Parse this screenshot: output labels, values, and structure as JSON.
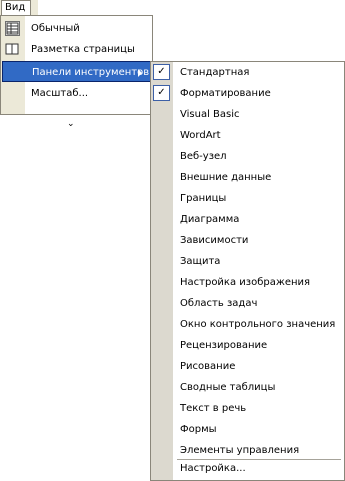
{
  "menubar": {
    "title": "Вид"
  },
  "view_menu": {
    "items": [
      {
        "label": "Обычный",
        "checked": true,
        "icon": "normal-view-icon"
      },
      {
        "label": "Разметка страницы",
        "checked": false,
        "icon": "print-layout-icon"
      },
      {
        "label": "Панели инструментов",
        "highlighted": true,
        "submenu": true
      },
      {
        "label": "Масштаб..."
      }
    ],
    "more_glyph": "⌄"
  },
  "toolbars_submenu": {
    "items": [
      {
        "label": "Стандартная",
        "checked": true
      },
      {
        "label": "Форматирование",
        "checked": true
      },
      {
        "label": "Visual Basic",
        "checked": false
      },
      {
        "label": "WordArt",
        "checked": false
      },
      {
        "label": "Веб-узел",
        "checked": false
      },
      {
        "label": "Внешние данные",
        "checked": false
      },
      {
        "label": "Границы",
        "checked": false
      },
      {
        "label": "Диаграмма",
        "checked": false
      },
      {
        "label": "Зависимости",
        "checked": false
      },
      {
        "label": "Защита",
        "checked": false
      },
      {
        "label": "Настройка изображения",
        "checked": false
      },
      {
        "label": "Область задач",
        "checked": false
      },
      {
        "label": "Окно контрольного значения",
        "checked": false
      },
      {
        "label": "Рецензирование",
        "checked": false
      },
      {
        "label": "Рисование",
        "checked": false
      },
      {
        "label": "Сводные таблицы",
        "checked": false
      },
      {
        "label": "Текст в речь",
        "checked": false
      },
      {
        "label": "Формы",
        "checked": false
      },
      {
        "label": "Элементы управления",
        "checked": false
      }
    ],
    "customize_label": "Настройка..."
  },
  "colors": {
    "highlight": "#316ac5",
    "menubar": "#ece9d8",
    "gutter": "#dcd9cf"
  }
}
